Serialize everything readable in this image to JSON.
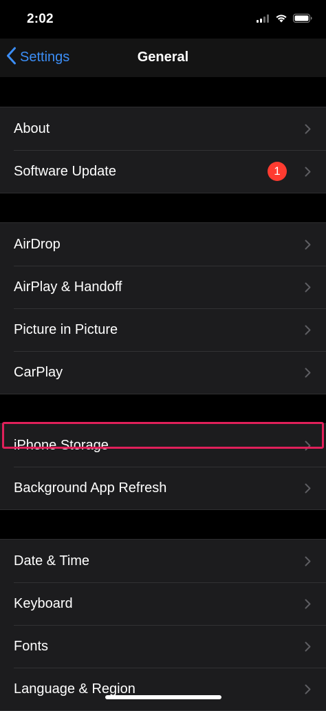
{
  "status_bar": {
    "time": "2:02",
    "icons": [
      "signal-bars-icon",
      "wifi-icon",
      "battery-icon"
    ]
  },
  "nav": {
    "back_label": "Settings",
    "title": "General"
  },
  "groups": [
    {
      "items": [
        {
          "label": "About"
        },
        {
          "label": "Software Update",
          "badge": "1"
        }
      ]
    },
    {
      "items": [
        {
          "label": "AirDrop"
        },
        {
          "label": "AirPlay & Handoff"
        },
        {
          "label": "Picture in Picture"
        },
        {
          "label": "CarPlay"
        }
      ]
    },
    {
      "items": [
        {
          "label": "iPhone Storage",
          "highlighted": true
        },
        {
          "label": "Background App Refresh"
        }
      ]
    },
    {
      "items": [
        {
          "label": "Date & Time"
        },
        {
          "label": "Keyboard"
        },
        {
          "label": "Fonts"
        },
        {
          "label": "Language & Region"
        }
      ]
    }
  ],
  "colors": {
    "accent": "#3c8ef6",
    "badge": "#ff3b30",
    "highlight": "#e0205a",
    "cell_background": "#1c1c1e",
    "background": "#000000"
  }
}
